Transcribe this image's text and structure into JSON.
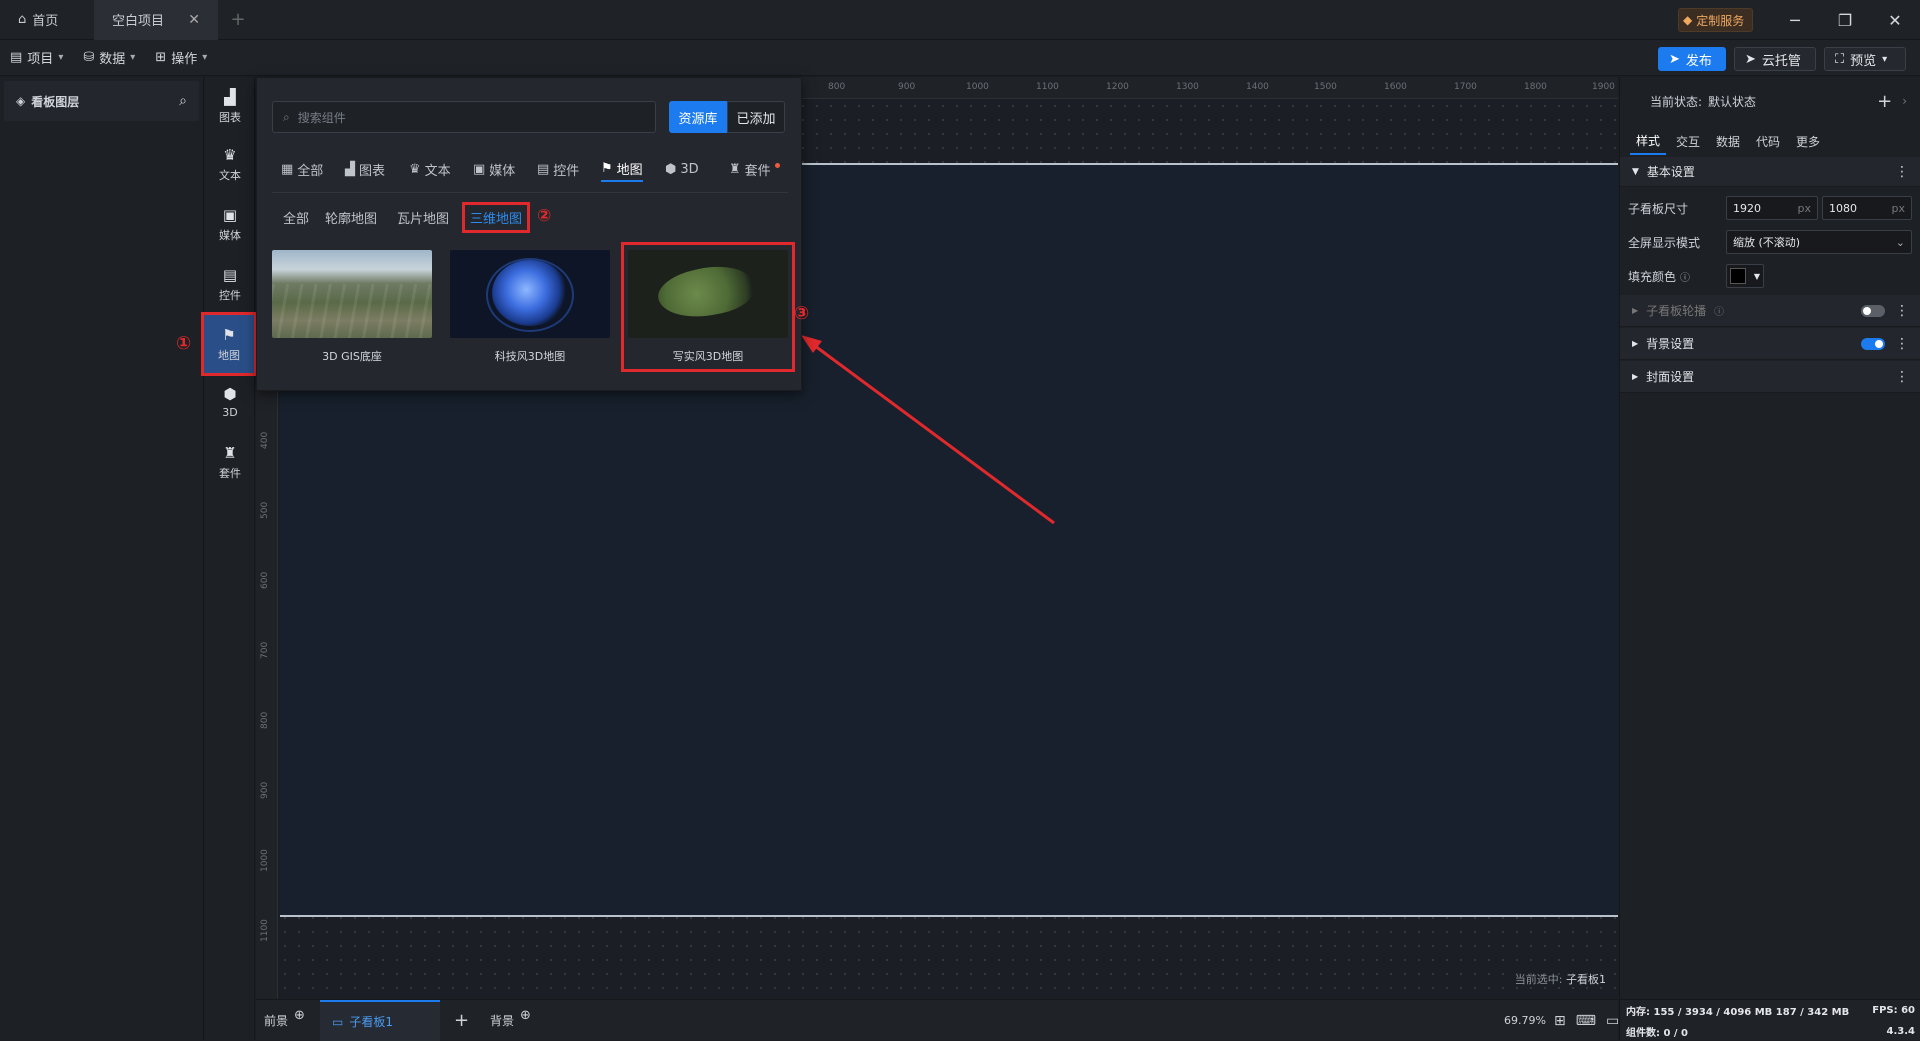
{
  "titlebar": {
    "home": "首页",
    "active_tab": "空白项目",
    "custom_service": "定制服务"
  },
  "toolbar": {
    "project": "项目",
    "data": "数据",
    "operate": "操作",
    "publish": "发布",
    "cloud": "云托管",
    "preview": "预览"
  },
  "layers": {
    "title": "看板图层"
  },
  "iconbar": [
    {
      "label": "图表",
      "icon": "bar-chart-icon"
    },
    {
      "label": "文本",
      "icon": "text-icon"
    },
    {
      "label": "媒体",
      "icon": "media-icon"
    },
    {
      "label": "控件",
      "icon": "control-icon"
    },
    {
      "label": "地图",
      "icon": "map-icon"
    },
    {
      "label": "3D",
      "icon": "cube-icon"
    },
    {
      "label": "套件",
      "icon": "kit-icon"
    }
  ],
  "popup": {
    "search_placeholder": "搜索组件",
    "lib": "资源库",
    "added": "已添加",
    "categories": [
      "全部",
      "图表",
      "文本",
      "媒体",
      "控件",
      "地图",
      "3D",
      "套件"
    ],
    "subcategories": [
      "全部",
      "轮廓地图",
      "瓦片地图",
      "三维地图"
    ],
    "cards": [
      "3D GIS底座",
      "科技风3D地图",
      "写实风3D地图"
    ]
  },
  "ruler": {
    "top": [
      "800",
      "900",
      "1000",
      "1100",
      "1200",
      "1300",
      "1400",
      "1500",
      "1600",
      "1700",
      "1800",
      "1900"
    ],
    "left": [
      "400",
      "500",
      "600",
      "700",
      "800",
      "900",
      "1000",
      "1100"
    ]
  },
  "canvas": {
    "current_label": "当前选中:",
    "current_value": "子看板1"
  },
  "bottombar": {
    "front": "前景",
    "board": "子看板1",
    "back": "背景",
    "zoom": "69.79%"
  },
  "right": {
    "state_label": "当前状态:",
    "state_value": "默认状态",
    "tabs": [
      "样式",
      "交互",
      "数据",
      "代码",
      "更多"
    ],
    "basic": "基本设置",
    "size_label": "子看板尺寸",
    "width": "1920",
    "height": "1080",
    "px": "px",
    "fullscreen_label": "全屏显示模式",
    "fullscreen_value": "缩放 (不滚动)",
    "fill_label": "填充颜色",
    "carousel": "子看板轮播",
    "bg": "背景设置",
    "cover": "封面设置",
    "status_mem": "内存: 155 / 3934 / 4096 MB 187 / 342 MB",
    "status_fps": "FPS: 60",
    "status_count": "组件数: 0 / 0",
    "version": "4.3.4"
  },
  "annotations": {
    "n1": "①",
    "n2": "②",
    "n3": "③"
  },
  "colors": {
    "accent": "#1d7bf0",
    "annotation": "#e0292c"
  }
}
